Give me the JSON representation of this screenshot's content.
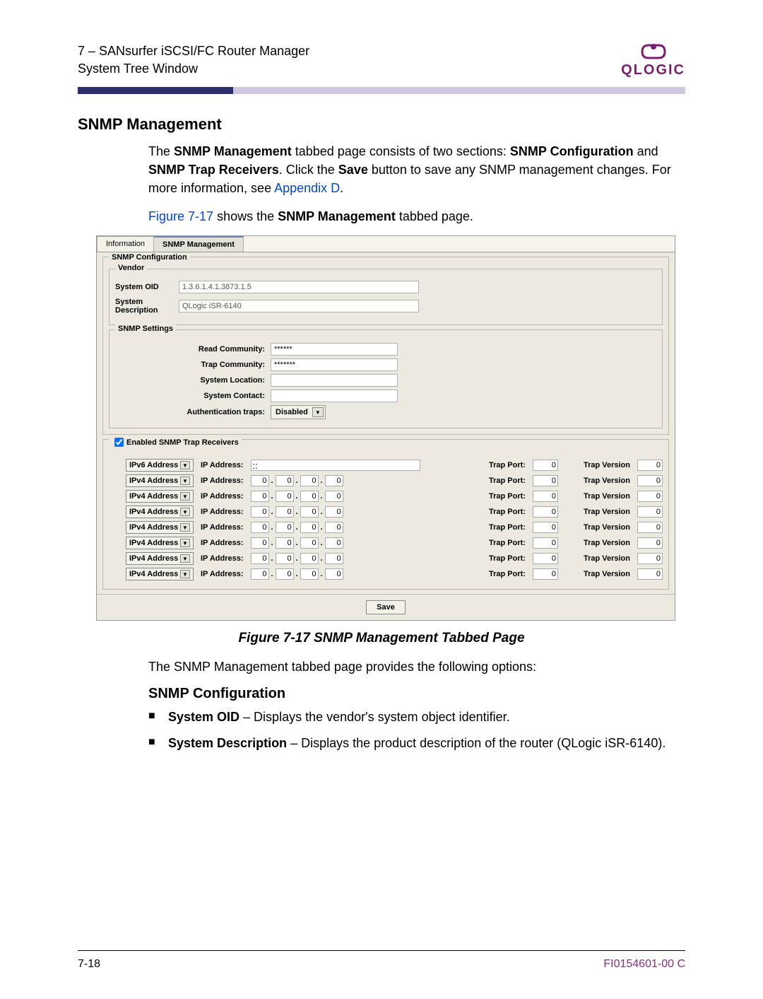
{
  "header": {
    "chapter": "7 – SANsurfer iSCSI/FC Router Manager",
    "section": "System Tree Window",
    "brand": "QLOGIC"
  },
  "content": {
    "h1": "SNMP Management",
    "intro1a": "The ",
    "intro1b": "SNMP Management",
    "intro1c": " tabbed page consists of two sections: ",
    "intro1d": "SNMP Configuration",
    "intro1e": " and ",
    "intro1f": "SNMP Trap Receivers",
    "intro1g": ". Click the ",
    "intro1h": "Save",
    "intro1i": " button to save any SNMP management changes. For more information, see ",
    "intro_link": "Appendix D",
    "intro1j": ".",
    "figref": "Figure 7-17",
    "figref_txt": " shows the ",
    "figref_bold": "SNMP Management",
    "figref_txt2": " tabbed page.",
    "caption": "Figure 7-17  SNMP Management Tabbed Page",
    "after_fig": "The SNMP Management tabbed page provides the following options:",
    "h2": "SNMP Configuration",
    "bullets": [
      {
        "b": "System OID",
        "t": " – Displays the vendor's system object identifier."
      },
      {
        "b": "System Description",
        "t": " – Displays the product description of the router (QLogic iSR-6140)."
      }
    ]
  },
  "panel": {
    "tabs": [
      "Information",
      "SNMP Management"
    ],
    "active_tab": 1,
    "group_config": "SNMP Configuration",
    "vendor_legend": "Vendor",
    "vendor_rows": [
      {
        "label": "System OID",
        "value": "1.3.6.1.4.1.3873.1.5"
      },
      {
        "label": "System Description",
        "value": "QLogic iSR-6140"
      }
    ],
    "settings_legend": "SNMP Settings",
    "settings_rows": [
      {
        "label": "Read Community:",
        "value": "******"
      },
      {
        "label": "Trap Community:",
        "value": "*******"
      },
      {
        "label": "System Location:",
        "value": ""
      },
      {
        "label": "System Contact:",
        "value": ""
      }
    ],
    "auth_traps_label": "Authentication traps:",
    "auth_traps_value": "Disabled",
    "cb_label": "Enabled SNMP Trap Receivers",
    "trap_rows": [
      {
        "type": "IPv6 Address",
        "ip6": "::",
        "port": "0",
        "ver": "0"
      },
      {
        "type": "IPv4 Address",
        "octets": [
          "0",
          "0",
          "0",
          "0"
        ],
        "port": "0",
        "ver": "0"
      },
      {
        "type": "IPv4 Address",
        "octets": [
          "0",
          "0",
          "0",
          "0"
        ],
        "port": "0",
        "ver": "0"
      },
      {
        "type": "IPv4 Address",
        "octets": [
          "0",
          "0",
          "0",
          "0"
        ],
        "port": "0",
        "ver": "0"
      },
      {
        "type": "IPv4 Address",
        "octets": [
          "0",
          "0",
          "0",
          "0"
        ],
        "port": "0",
        "ver": "0"
      },
      {
        "type": "IPv4 Address",
        "octets": [
          "0",
          "0",
          "0",
          "0"
        ],
        "port": "0",
        "ver": "0"
      },
      {
        "type": "IPv4 Address",
        "octets": [
          "0",
          "0",
          "0",
          "0"
        ],
        "port": "0",
        "ver": "0"
      },
      {
        "type": "IPv4 Address",
        "octets": [
          "0",
          "0",
          "0",
          "0"
        ],
        "port": "0",
        "ver": "0"
      }
    ],
    "col_ipaddr": "IP Address:",
    "col_trapport": "Trap Port:",
    "col_trapver": "Trap Version",
    "save_label": "Save"
  },
  "footer": {
    "page": "7-18",
    "docnum": "FI0154601-00  C"
  }
}
